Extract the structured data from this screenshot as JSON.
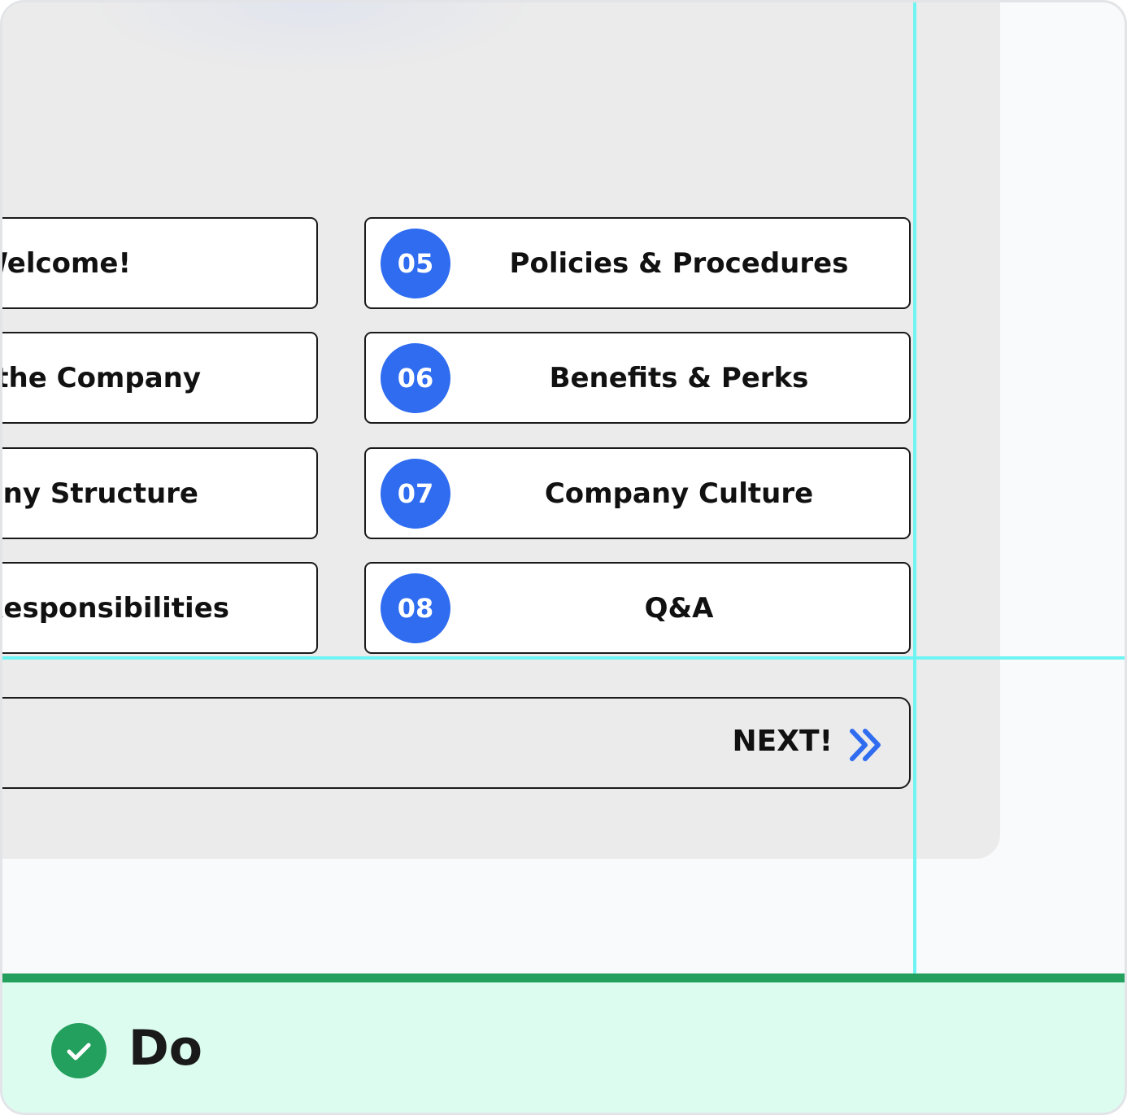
{
  "agenda": {
    "left_items": [
      {
        "label": "Welcome!"
      },
      {
        "label": "About the Company"
      },
      {
        "label": "Company Structure"
      },
      {
        "label": "Roles & Responsibilities"
      }
    ],
    "right_items": [
      {
        "number": "05",
        "label": "Policies & Procedures"
      },
      {
        "number": "06",
        "label": "Benefits & Perks"
      },
      {
        "number": "07",
        "label": "Company Culture"
      },
      {
        "number": "08",
        "label": "Q&A"
      }
    ]
  },
  "navigation": {
    "next_label": "NEXT!",
    "next_icon": "double-chevron-right-icon"
  },
  "footer": {
    "label": "Do",
    "icon": "check-circle-icon"
  },
  "colors": {
    "badge": "#2f6cf0",
    "guide": "#6ef5f3",
    "success": "#23a05e",
    "footer_bg": "#dcfcef",
    "panel_bg": "#ebebeb"
  }
}
